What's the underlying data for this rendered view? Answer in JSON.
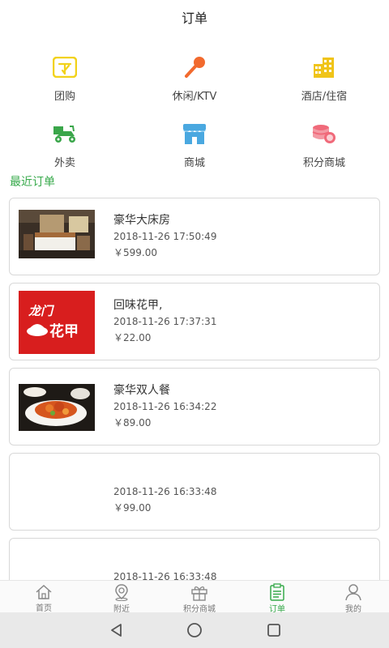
{
  "header": {
    "title": "订单"
  },
  "categories": [
    {
      "label": "团购",
      "icon": "group-buy-icon",
      "color": "#f2d21a"
    },
    {
      "label": "休闲/KTV",
      "icon": "microphone-icon",
      "color": "#f26a2e"
    },
    {
      "label": "酒店/住宿",
      "icon": "hotel-buildings-icon",
      "color": "#f0c419"
    },
    {
      "label": "外卖",
      "icon": "delivery-scooter-icon",
      "color": "#3aa64a"
    },
    {
      "label": "商城",
      "icon": "shop-icon",
      "color": "#4aa8e0"
    },
    {
      "label": "积分商城",
      "icon": "points-coins-icon",
      "color": "#f06a7a"
    }
  ],
  "section": {
    "recent_orders": "最近订单"
  },
  "orders": [
    {
      "name": "豪华大床房",
      "time": "2018-11-26 17:50:49",
      "price": "￥599.00",
      "image": "hotel-room-photo"
    },
    {
      "name": "回味花甲,",
      "time": "2018-11-26 17:37:31",
      "price": "￥22.00",
      "image": "longmen-huajia-logo",
      "logo_text_top": "龙门",
      "logo_text_bottom": "花甲"
    },
    {
      "name": "豪华双人餐",
      "time": "2018-11-26 16:34:22",
      "price": "￥89.00",
      "image": "food-plate-photo"
    },
    {
      "name": "",
      "time": "2018-11-26 16:33:48",
      "price": "￥99.00",
      "image": ""
    },
    {
      "name": "",
      "time": "2018-11-26 16:33:48",
      "price": "",
      "image": ""
    }
  ],
  "tabbar": {
    "items": [
      {
        "label": "首页",
        "icon": "home-icon",
        "active": false
      },
      {
        "label": "附近",
        "icon": "location-icon",
        "active": false
      },
      {
        "label": "积分商城",
        "icon": "gift-icon",
        "active": false
      },
      {
        "label": "订单",
        "icon": "clipboard-icon",
        "active": true
      },
      {
        "label": "我的",
        "icon": "user-icon",
        "active": false
      }
    ],
    "active_color": "#36a94a"
  }
}
